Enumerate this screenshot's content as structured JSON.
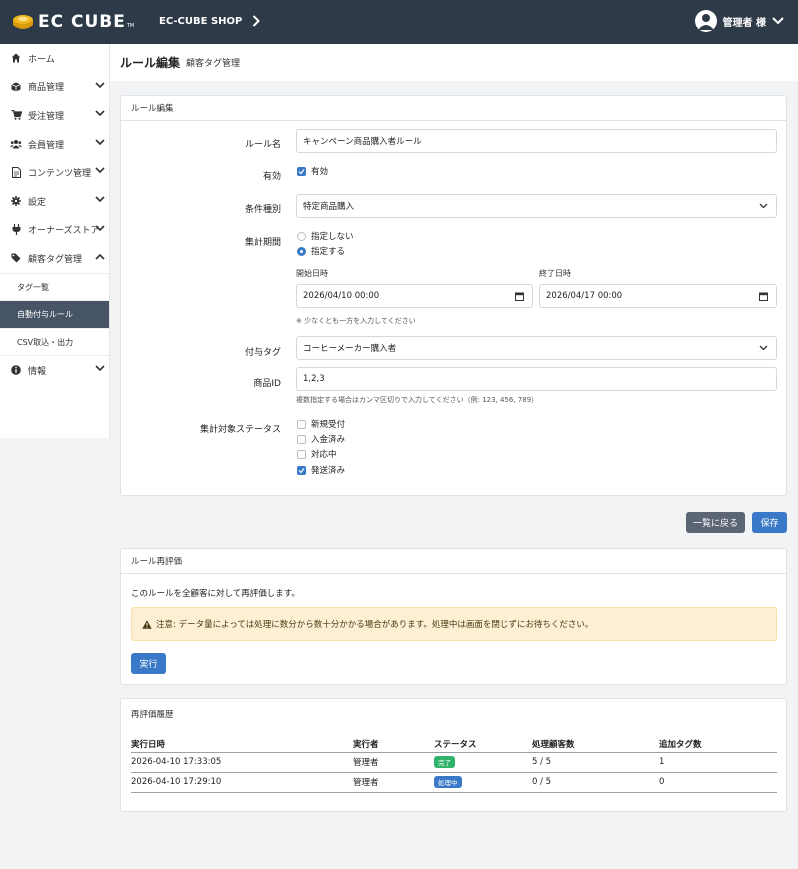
{
  "topbar": {
    "logo_text": "EC CUBE",
    "logo_tm": "TM",
    "shop_name": "EC-CUBE SHOP",
    "user_label": "管理者 様"
  },
  "sidebar": {
    "items": [
      {
        "label": "ホーム",
        "icon": "home-icon"
      },
      {
        "label": "商品管理",
        "icon": "box-icon"
      },
      {
        "label": "受注管理",
        "icon": "cart-icon"
      },
      {
        "label": "会員管理",
        "icon": "users-icon"
      },
      {
        "label": "コンテンツ管理",
        "icon": "file-icon"
      },
      {
        "label": "設定",
        "icon": "gear-icon"
      },
      {
        "label": "オーナーズストア",
        "icon": "plug-icon"
      },
      {
        "label": "顧客タグ管理",
        "icon": "tags-icon"
      }
    ],
    "subitems": [
      {
        "label": "タグ一覧"
      },
      {
        "label": "自動付与ルール"
      },
      {
        "label": "CSV取込・出力"
      }
    ],
    "last_item": {
      "label": "情報",
      "icon": "info-icon"
    }
  },
  "header": {
    "title": "ルール編集",
    "subtitle": "顧客タグ管理"
  },
  "form": {
    "card_title": "ルール編集",
    "rule_name_label": "ルール名",
    "rule_name_value": "キャンペーン商品購入者ルール",
    "enabled_label": "有効",
    "enabled_option": "有効",
    "condition_label": "条件種別",
    "condition_value": "特定商品購入",
    "period_label": "集計期間",
    "period_options": [
      "指定しない",
      "指定する"
    ],
    "start_label": "開始日時",
    "start_value": "2026/04/10 00:00",
    "end_label": "終了日時",
    "end_value": "2026/04/17 00:00",
    "period_help": "※ 少なくとも一方を入力してください",
    "tag_label": "付与タグ",
    "tag_value": "コーヒーメーカー購入者",
    "product_label": "商品ID",
    "product_value": "1,2,3",
    "product_help": "複数指定する場合はカンマ区切りで入力してください（例: 123, 456, 789）",
    "status_label": "集計対象ステータス",
    "status_options": [
      "新規受付",
      "入金済み",
      "対応中",
      "発送済み"
    ]
  },
  "actions": {
    "back_label": "一覧に戻る",
    "save_label": "保存"
  },
  "reeval": {
    "card_title": "ルール再評価",
    "description": "このルールを全顧客に対して再評価します。",
    "alert_text": "注意: データ量によっては処理に数分から数十分かかる場合があります。処理中は画面を閉じずにお待ちください。",
    "run_label": "実行"
  },
  "history": {
    "card_title": "再評価履歴",
    "columns": [
      "実行日時",
      "実行者",
      "ステータス",
      "処理顧客数",
      "追加タグ数"
    ],
    "rows": [
      {
        "date": "2026-04-10 17:33:05",
        "user": "管理者",
        "status": "完了",
        "processed": "5 / 5",
        "added": "1"
      },
      {
        "date": "2026-04-10 17:29:10",
        "user": "管理者",
        "status": "処理中",
        "processed": "0 / 5",
        "added": "0"
      }
    ]
  },
  "colors": {
    "topbar": "#2f3a48",
    "primary": "#3a79c8",
    "badge_done": "#2fb36b",
    "badge_processing": "#3a79c8"
  }
}
